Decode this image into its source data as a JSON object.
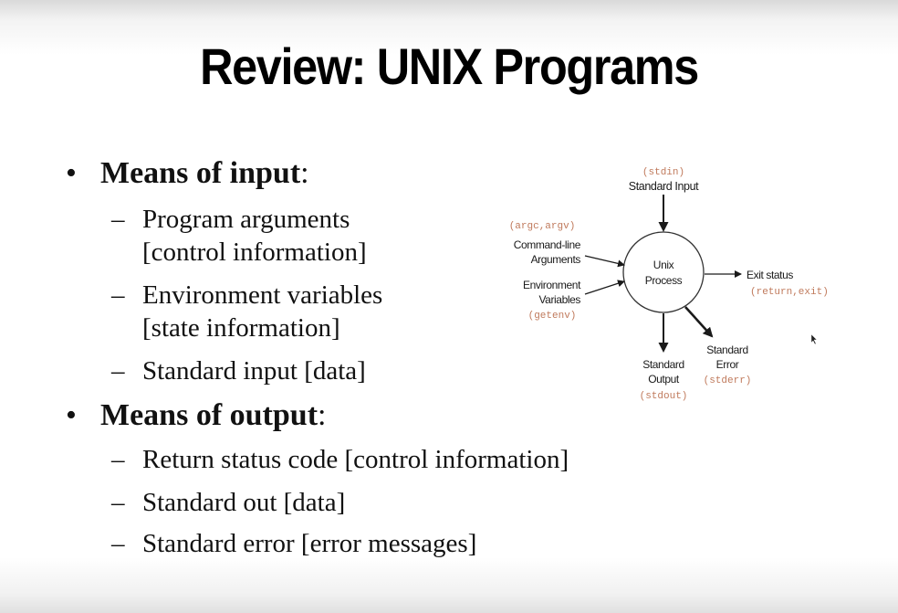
{
  "slide": {
    "title": "Review: UNIX Programs"
  },
  "bullets": {
    "input": {
      "marker": "•",
      "heading": "Means of input",
      "colon": ":",
      "items": [
        {
          "marker": "–",
          "line1": "Program arguments",
          "line2": "[control information]"
        },
        {
          "marker": "–",
          "line1": "Environment variables",
          "line2": "[state information]"
        },
        {
          "marker": "–",
          "line1": "Standard input [data]"
        }
      ]
    },
    "output": {
      "marker": "•",
      "heading": "Means of output",
      "colon": ":",
      "items": [
        {
          "marker": "–",
          "line1": "Return status code [control information]"
        },
        {
          "marker": "–",
          "line1": "Standard out [data]"
        },
        {
          "marker": "–",
          "line1": "Standard error [error messages]"
        }
      ]
    }
  },
  "diagram": {
    "process_label_1": "Unix",
    "process_label_2": "Process",
    "stdin_code": "(stdin)",
    "stdin_label": "Standard Input",
    "args_code": "(argc,argv)",
    "args_label_1": "Command-line",
    "args_label_2": "Arguments",
    "env_label_1": "Environment",
    "env_label_2": "Variables",
    "env_code": "(getenv)",
    "exit_label": "Exit status",
    "exit_code": "(return,exit)",
    "stdout_label_1": "Standard",
    "stdout_label_2": "Output",
    "stdout_code": "(stdout)",
    "stderr_label_1": "Standard",
    "stderr_label_2": "Error",
    "stderr_code": "(stderr)",
    "code_color": "#c07a5c"
  }
}
